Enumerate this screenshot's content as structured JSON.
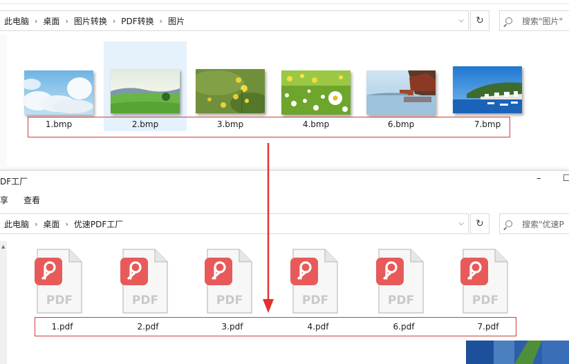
{
  "window_top": {
    "breadcrumb": [
      "此电脑",
      "桌面",
      "图片转换",
      "PDF转换",
      "图片"
    ],
    "search_placeholder": "搜索\"图片\"",
    "files": [
      {
        "name": "1.bmp",
        "scene": "sky-clouds",
        "selected": false
      },
      {
        "name": "2.bmp",
        "scene": "green-field",
        "selected": true
      },
      {
        "name": "3.bmp",
        "scene": "yellow-flowers",
        "selected": false
      },
      {
        "name": "4.bmp",
        "scene": "daisy-meadow",
        "selected": false
      },
      {
        "name": "6.bmp",
        "scene": "lake-boathouse",
        "selected": false
      },
      {
        "name": "7.bmp",
        "scene": "harbor-town",
        "selected": false
      }
    ]
  },
  "window_bottom": {
    "title": "DF工厂",
    "ribbon_tabs": [
      "享",
      "查看"
    ],
    "breadcrumb": [
      "此电脑",
      "桌面",
      "优速PDF工厂"
    ],
    "search_placeholder": "搜索\"优速P",
    "files": [
      {
        "name": "1.pdf",
        "badge": "PDF"
      },
      {
        "name": "2.pdf",
        "badge": "PDF"
      },
      {
        "name": "3.pdf",
        "badge": "PDF"
      },
      {
        "name": "4.pdf",
        "badge": "PDF"
      },
      {
        "name": "6.pdf",
        "badge": "PDF"
      },
      {
        "name": "7.pdf",
        "badge": "PDF"
      }
    ],
    "window_controls": {
      "minimize": "–",
      "maximize": "☐"
    }
  },
  "colors": {
    "highlight_box": "#d23a3a",
    "arrow": "#e23030",
    "selection": "#e5f1fb",
    "pdf_badge": "#e85a5a"
  }
}
